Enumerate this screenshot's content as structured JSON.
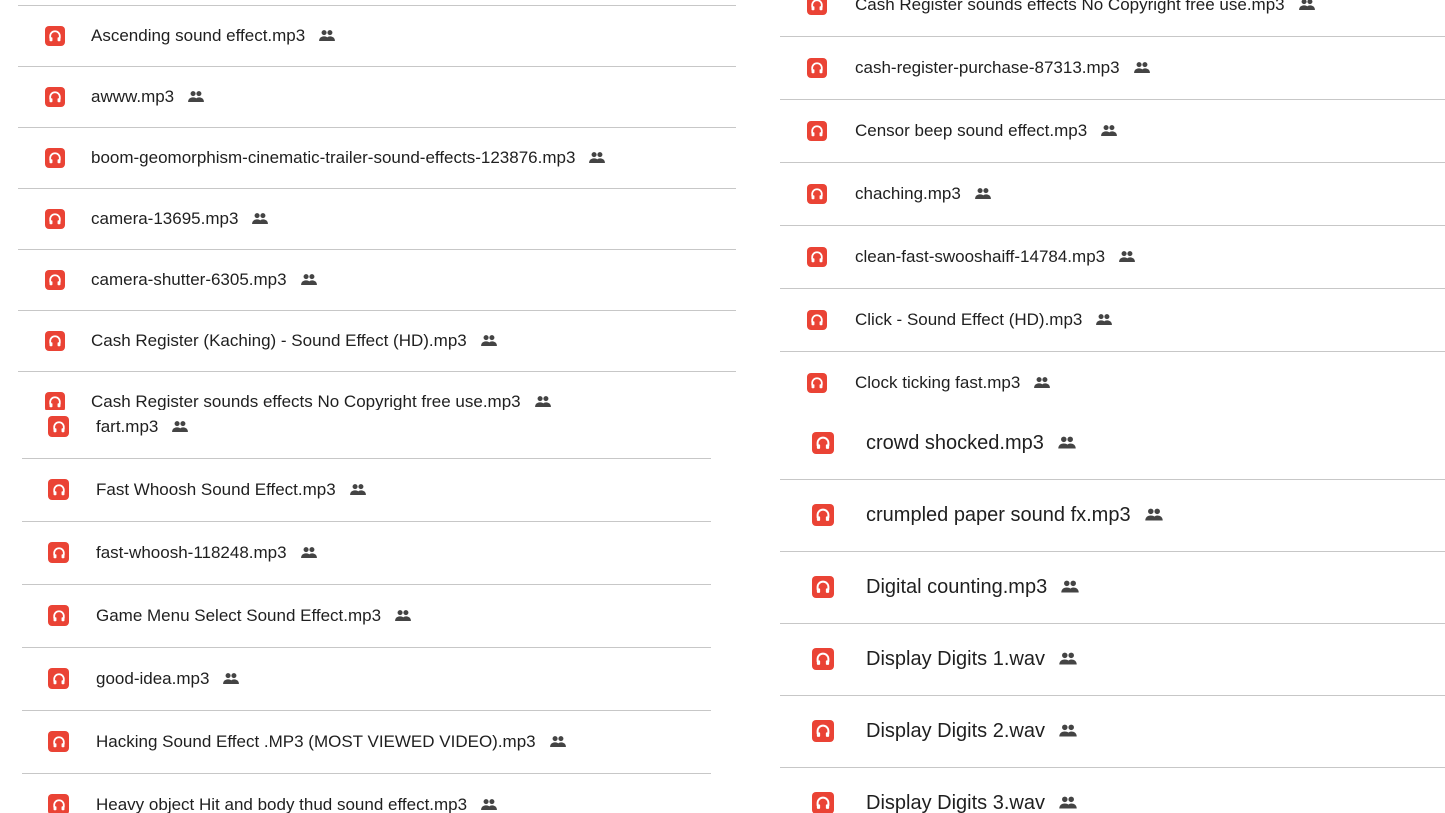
{
  "colors": {
    "file_icon": "#ea4335",
    "divider": "#c7c7c7",
    "text": "#1f1f1f"
  },
  "icons": {
    "file": "audio-file-icon",
    "shared": "shared-people-icon"
  },
  "panels": [
    {
      "id": "p1",
      "files": [
        "Ascending sound effect.mp3",
        "awww.mp3",
        "boom-geomorphism-cinematic-trailer-sound-effects-123876.mp3",
        "camera-13695.mp3",
        "camera-shutter-6305.mp3",
        "Cash Register (Kaching) - Sound Effect (HD).mp3",
        "Cash Register sounds effects No Copyright free use.mp3"
      ]
    },
    {
      "id": "p2",
      "files": [
        "fart.mp3",
        "Fast Whoosh Sound Effect.mp3",
        "fast-whoosh-118248.mp3",
        "Game Menu Select Sound Effect.mp3",
        "good-idea.mp3",
        "Hacking Sound Effect .MP3 (MOST VIEWED VIDEO).mp3",
        "Heavy object Hit and body thud sound effect.mp3"
      ]
    },
    {
      "id": "p3",
      "files": [
        "Cash Register sounds effects No Copyright free use.mp3",
        "cash-register-purchase-87313.mp3",
        "Censor beep sound effect.mp3",
        "chaching.mp3",
        "clean-fast-swooshaiff-14784.mp3",
        "Click - Sound Effect (HD).mp3",
        "Clock ticking fast.mp3"
      ]
    },
    {
      "id": "p4",
      "files": [
        "crowd shocked.mp3",
        "crumpled paper sound fx.mp3",
        "Digital counting.mp3",
        "Display Digits 1.wav",
        "Display Digits 2.wav",
        "Display Digits 3.wav"
      ]
    }
  ]
}
